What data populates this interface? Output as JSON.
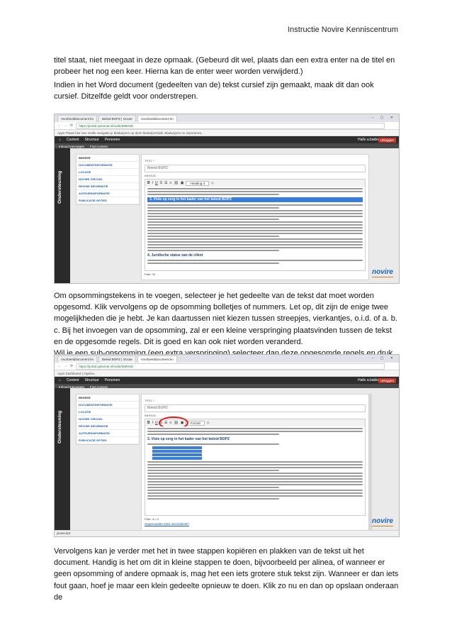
{
  "header": {
    "title": "Instructie Novire Kenniscentrum"
  },
  "paragraphs": {
    "p1": "titel staat, niet meegaat in deze opmaak. (Gebeurd dit wel, plaats dan een extra enter na de titel en probeer het nog een keer. Hierna kan de enter weer worden verwijderd.)",
    "p2": "Indien in het Word document (gedeelten van de) tekst cursief zijn gemaakt, maak dit dan ook cursief. Ditzelfde geldt voor onderstrepen.",
    "p3": "Om opsommingstekens in te voegen, selecteer je het gedeelte van de tekst dat moet worden opgesomd. Klik vervolgens op de opsomming bolletjes of nummers. Let op, dit zijn de enige twee mogelijkheden die je hebt. Je kan daartussen niet kiezen tussen streepjes, vierkantjes, o.i.d. of a. b. c. Bij het invoegen van de opsomming, zal er een kleine verspringing plaatsvinden tussen de tekst en de opgesomde regels. Dit is goed en kan ook niet worden veranderd.",
    "p4": "Wil je een sub-opsomming (een extra verspringing) selecteer dan deze opgesomde regels en druk op de tab-toets. Alleen deze paar regels zullen hierdoor extra verspringen.",
    "p5": "Vervolgens kan je verder met het in twee stappen kopiëren en plakken van de tekst uit het document. Handig is het om dit in kleine stappen te doen, bijvoorbeeld per alinea, of wanneer er geen opsomming of andere opmaak is, mag het een iets grotere stuk tekst zijn. Wanneer er dan iets fout gaan, hoef je maar een klein gedeelte opnieuw te doen. Klik zo nu en dan op opslaan onderaan de"
  },
  "screenshot1": {
    "tabs": [
      "Voorbeelddocument kn",
      "Beleid BOPZ | GUute",
      "Voorbeelddocument kn"
    ],
    "url": "https://portal.quitomar.nl/node/396/edit",
    "bookmarks": "Apps   Plaats hier een snelle navigatie je bladwijzers op deze bladwijzerbalk.  Bladwijzers nu importeren...",
    "menu": [
      "Content",
      "Structuur",
      "Personen"
    ],
    "submenu": [
      "Inhoud toevoegen",
      "Find content"
    ],
    "user": "Hallo a.bakker",
    "logout": "Uitloggen",
    "side_tab": "Ondersteuning",
    "panel_head": "BEHEER",
    "panel_items": [
      "DOCUMENTINFORMATIE",
      "LOCATIE",
      "NOVIRE CIRCUEL",
      "REVISIE INFORMATIE",
      "AUTEURSINFORMATIE",
      "PUBLICATIE-OPTIES"
    ],
    "title_label": "TITEL *",
    "title_value": "Beleid BOPZ",
    "body_label": "INHOUD",
    "format_select": "Heading 3",
    "heading": "3. Visie op zorg in het kader van het beleid BOPZ",
    "heading2": "4. Juridische status van de cliënt",
    "path": "Path: h3",
    "brand": "novire"
  },
  "screenshot2": {
    "tabs": [
      "Voorbeelddocument kn",
      "Beleid BOPZ | GUute",
      "Voorbeelddocument kn"
    ],
    "url": "https://portal.quitomar.nl/node/396/edit",
    "bookmarks": "Apps   Dashboard | Ingelos...",
    "menu": [
      "Content",
      "Structuur",
      "Personen"
    ],
    "submenu": [
      "Inhoud toevoegen",
      "Find content"
    ],
    "user": "Hallo a.bakker",
    "logout": "Uitloggen",
    "side_tab": "Ondersteuning",
    "panel_head": "BEHEER",
    "panel_items": [
      "DOCUMENTINFORMATIE",
      "LOCATIE",
      "NOVIRE CIRCUEL",
      "REVISIE INFORMATIE",
      "AUTEURSINFORMATIE",
      "PUBLICATIE-OPTIES"
    ],
    "title_label": "TITEL *",
    "title_value": "Beleid BOPZ",
    "body_label": "INHOUD",
    "format_select": "Format",
    "heading": "3. Visie op zorg in het kader van het beleid BOPZ",
    "path": "Path: ul » li",
    "save_link": "Opgemaakte tekst uitschakelen",
    "status": "javascript:",
    "brand": "novire"
  }
}
